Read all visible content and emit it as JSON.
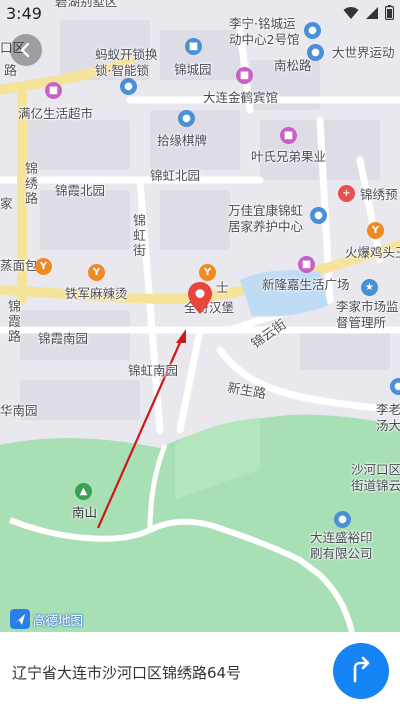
{
  "status_bar": {
    "time": "3:49",
    "icons": [
      "wifi-icon",
      "signal-icon",
      "battery-icon"
    ]
  },
  "map": {
    "provider_logo": "高德地图",
    "labels": {
      "top_area": "碧湖别墅区",
      "lining": "李宁·铭城运\n动中心2号馆",
      "dashijie": "大世界运动",
      "mayi": "蚂蚁开锁换\n锁·智能锁",
      "jinchengyuan": "锦城园",
      "nansong": "南松路",
      "manyi": "满亿生活超市",
      "jinhe": "大连金鹤宾馆",
      "shiyuan": "拾缘棋牌",
      "yeshi": "叶氏兄弟果业",
      "jinxiulu": "锦绣路",
      "jinxiabei": "锦霞北园",
      "jinhongbei": "锦虹北园",
      "jinxiuyu": "锦绣预",
      "jia": "家",
      "wanjia": "万佳宜康锦虹\n居家养护中心",
      "jinhongjie": "锦虹街",
      "huobao": "火爆鸡头王",
      "baozi": "蒸面包",
      "tiejun": "铁军麻辣烫",
      "xinlongjia": "新隆嘉生活广场",
      "lijia": "李家市场监\n督管理所",
      "quanqi": "全奇汉堡",
      "shi": "士",
      "jinxialu": "锦霞路",
      "jinxianan": "锦霞南园",
      "jinyunjie": "锦云街",
      "jinhongnan": "锦虹南园",
      "xinsheng": "新生路",
      "hua": "华南园",
      "lilao": "李老\n汤大",
      "nanshan": "南山",
      "shahekou": "沙河口区\n街道锦云",
      "dalian_print": "大连盛裕印\n刷有限公司",
      "left_top": "口区",
      "left_road": "路"
    }
  },
  "address": "辽宁省大连市沙河口区锦绣路64号",
  "colors": {
    "accent": "#1684f4",
    "marker": "#e8453c",
    "park": "#a8dfb4",
    "road": "#f6e39a",
    "water": "#bfdcf5",
    "arrow": "#d01818"
  }
}
